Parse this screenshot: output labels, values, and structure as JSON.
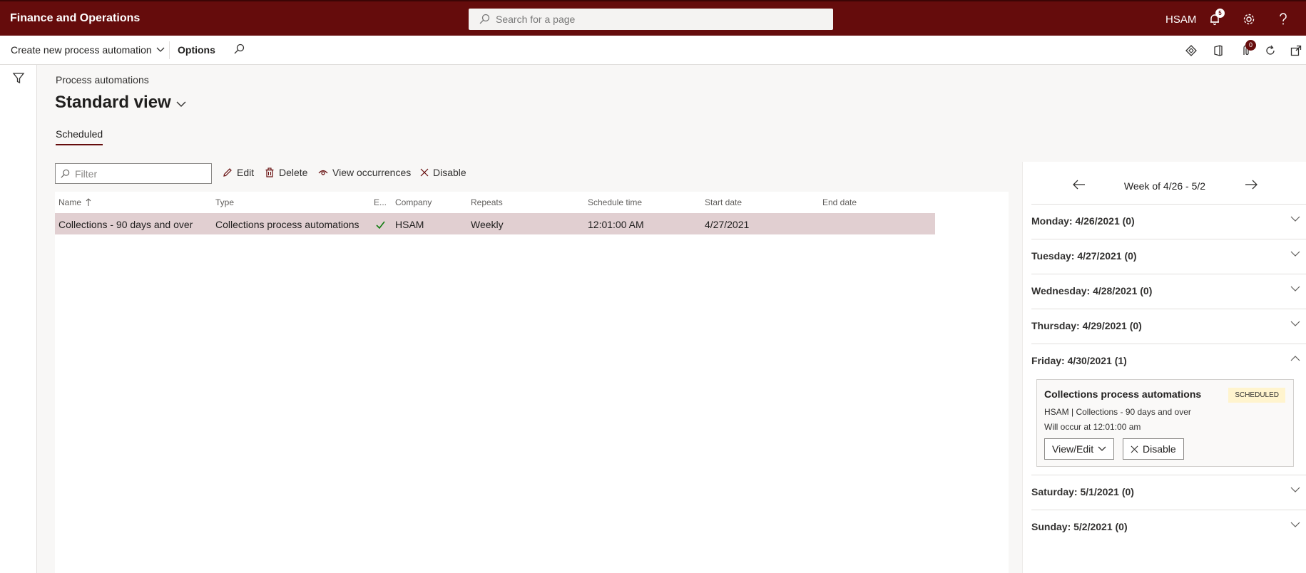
{
  "app": {
    "title": "Finance and Operations",
    "search_placeholder": "Search for a page",
    "company": "HSAM",
    "notification_count": "5"
  },
  "actionbar": {
    "create_label": "Create new process automation",
    "options_label": "Options",
    "badge_count": "0"
  },
  "page": {
    "breadcrumb": "Process automations",
    "title": "Standard view",
    "tab": "Scheduled"
  },
  "toolbar": {
    "filter_placeholder": "Filter",
    "edit": "Edit",
    "delete": "Delete",
    "view_occurrences": "View occurrences",
    "disable": "Disable"
  },
  "grid": {
    "columns": [
      "Name",
      "Type",
      "E...",
      "Company",
      "Repeats",
      "Schedule time",
      "Start date",
      "End date"
    ],
    "rows": [
      {
        "name": "Collections - 90 days and over",
        "type": "Collections process automations",
        "company": "HSAM",
        "repeats": "Weekly",
        "schedule_time": "12:01:00 AM",
        "start_date": "4/27/2021",
        "end_date": ""
      }
    ]
  },
  "calendar": {
    "week_label": "Week of 4/26 - 5/2",
    "days": [
      "Monday: 4/26/2021 (0)",
      "Tuesday: 4/27/2021 (0)",
      "Wednesday: 4/28/2021 (0)",
      "Thursday: 4/29/2021 (0)",
      "Friday: 4/30/2021 (1)",
      "Saturday: 5/1/2021 (0)",
      "Sunday: 5/2/2021 (0)"
    ],
    "event": {
      "title": "Collections process automations",
      "badge": "SCHEDULED",
      "line1": "HSAM | Collections - 90 days and over",
      "line2": "Will occur at 12:01:00 am",
      "view_edit": "View/Edit",
      "disable": "Disable"
    }
  },
  "colors": {
    "brand": "#650c0c",
    "row_selected": "#e1cfd1",
    "badge_bg": "#fff4ce"
  }
}
